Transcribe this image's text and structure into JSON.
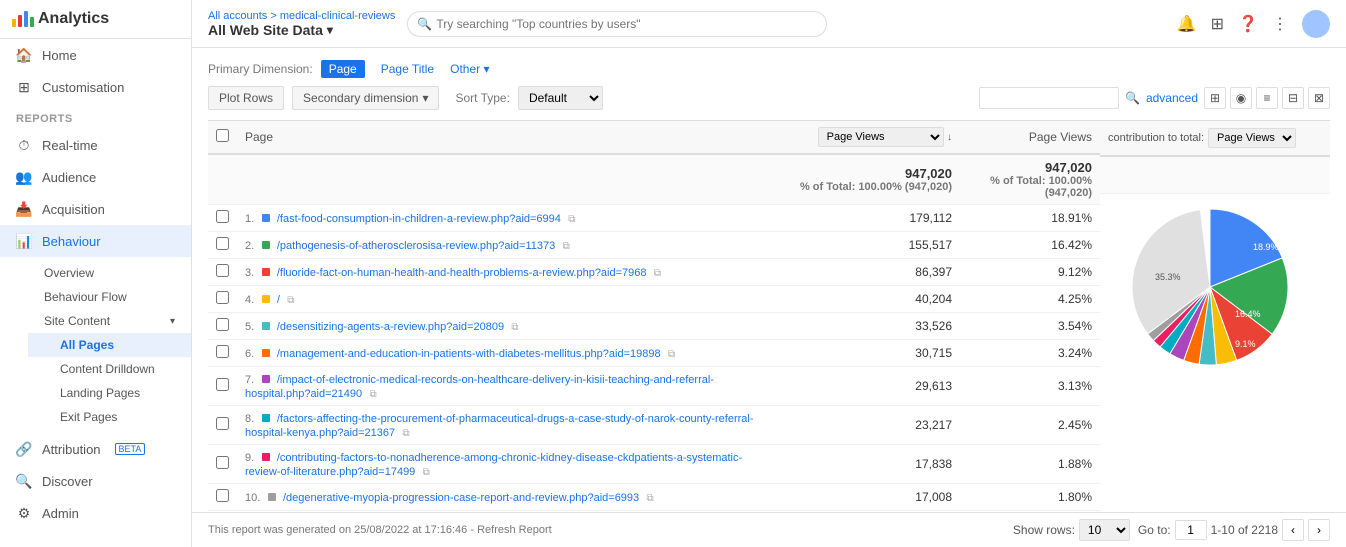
{
  "app": {
    "title": "Analytics",
    "logo_alt": "Google Analytics"
  },
  "topbar": {
    "breadcrumb": "All accounts > medical-clinical-reviews",
    "property": "All Web Site Data",
    "search_placeholder": "Try searching \"Top countries by users\""
  },
  "sidebar": {
    "nav_items": [
      {
        "id": "home",
        "label": "Home",
        "icon": "🏠"
      },
      {
        "id": "customisation",
        "label": "Customisation",
        "icon": "⊞"
      }
    ],
    "reports_label": "REPORTS",
    "report_items": [
      {
        "id": "realtime",
        "label": "Real-time",
        "icon": "⏱"
      },
      {
        "id": "audience",
        "label": "Audience",
        "icon": "👥"
      },
      {
        "id": "acquisition",
        "label": "Acquisition",
        "icon": "📥"
      },
      {
        "id": "behaviour",
        "label": "Behaviour",
        "icon": "📊",
        "active": true
      },
      {
        "id": "attribution",
        "label": "Attribution",
        "icon": "🔗",
        "badge": "BETA"
      },
      {
        "id": "discover",
        "label": "Discover",
        "icon": "🔍"
      },
      {
        "id": "admin",
        "label": "Admin",
        "icon": "⚙"
      }
    ],
    "behaviour_subitems": [
      {
        "id": "overview",
        "label": "Overview"
      },
      {
        "id": "behaviour-flow",
        "label": "Behaviour Flow"
      },
      {
        "id": "site-content",
        "label": "Site Content",
        "expandable": true
      },
      {
        "id": "all-pages",
        "label": "All Pages",
        "active": true
      },
      {
        "id": "content-drilldown",
        "label": "Content Drilldown"
      },
      {
        "id": "landing-pages",
        "label": "Landing Pages"
      },
      {
        "id": "exit-pages",
        "label": "Exit Pages"
      }
    ]
  },
  "primary_dimension": {
    "label": "Primary Dimension:",
    "options": [
      "Page",
      "Page Title",
      "Other ▾"
    ],
    "active": "Page"
  },
  "toolbar": {
    "plot_rows": "Plot Rows",
    "secondary_dim": "Secondary dimension",
    "sort_label": "Sort Type:",
    "sort_default": "Default",
    "advanced": "advanced"
  },
  "table": {
    "headers": {
      "page": "Page",
      "page_views_select": "Page Views",
      "page_views_col": "Page Views",
      "contribution_label": "contribution to total:",
      "contribution_select": "Page Views"
    },
    "total": {
      "value": "947,020",
      "pct_label": "% of Total: 100.00% (947,020)"
    },
    "rows": [
      {
        "num": "1",
        "color": "#4285f4",
        "url": "/fast-food-consumption-in-children-a-review.php?aid=6994",
        "views": "179,112",
        "pct": "18.91%"
      },
      {
        "num": "2",
        "color": "#34a853",
        "url": "/pathogenesis-of-atherosclerosisa-review.php?aid=11373",
        "views": "155,517",
        "pct": "16.42%"
      },
      {
        "num": "3",
        "color": "#ea4335",
        "url": "/fluoride-fact-on-human-health-and-health-problems-a-review.php?aid=7968",
        "views": "86,397",
        "pct": "9.12%"
      },
      {
        "num": "4",
        "color": "#fbbc04",
        "url": "/",
        "views": "40,204",
        "pct": "4.25%"
      },
      {
        "num": "5",
        "color": "#46bdc6",
        "url": "/desensitizing-agents-a-review.php?aid=20809",
        "views": "33,526",
        "pct": "3.54%"
      },
      {
        "num": "6",
        "color": "#ff6d00",
        "url": "/management-and-education-in-patients-with-diabetes-mellitus.php?aid=19898",
        "views": "30,715",
        "pct": "3.24%"
      },
      {
        "num": "7",
        "color": "#ab47bc",
        "url": "/impact-of-electronic-medical-records-on-healthcare-delivery-in-kisii-teaching-and-referral-hospital.php?aid=21490",
        "views": "29,613",
        "pct": "3.13%"
      },
      {
        "num": "8",
        "color": "#00acc1",
        "url": "/factors-affecting-the-procurement-of-pharmaceutical-drugs-a-case-study-of-narok-county-referral-hospital-kenya.php?aid=21367",
        "views": "23,217",
        "pct": "2.45%"
      },
      {
        "num": "9",
        "color": "#e91e63",
        "url": "/contributing-factors-to-nonadherence-among-chronic-kidney-disease-ckdpatients-a-systematic-review-of-literature.php?aid=17499",
        "views": "17,838",
        "pct": "1.88%"
      },
      {
        "num": "10",
        "color": "#9e9e9e",
        "url": "/degenerative-myopia-progression-case-report-and-review.php?aid=6993",
        "views": "17,008",
        "pct": "1.80%"
      }
    ]
  },
  "chart": {
    "segments": [
      {
        "label": "18.9%",
        "color": "#4285f4",
        "pct": 18.91,
        "startAngle": 0
      },
      {
        "label": "16.4%",
        "color": "#34a853",
        "pct": 16.42,
        "startAngle": 68
      },
      {
        "label": "9.1%",
        "color": "#ea4335",
        "pct": 9.12,
        "startAngle": 127
      },
      {
        "label": "4.25%",
        "color": "#fbbc04",
        "pct": 4.25,
        "startAngle": 160
      },
      {
        "label": "3.54%",
        "color": "#46bdc6",
        "pct": 3.54,
        "startAngle": 175
      },
      {
        "label": "3.24%",
        "color": "#ff6d00",
        "pct": 3.24,
        "startAngle": 188
      },
      {
        "label": "3.13%",
        "color": "#ab47bc",
        "pct": 3.13,
        "startAngle": 200
      },
      {
        "label": "2.45%",
        "color": "#00acc1",
        "pct": 2.45,
        "startAngle": 211
      },
      {
        "label": "1.88%",
        "color": "#e91e63",
        "pct": 1.88,
        "startAngle": 220
      },
      {
        "label": "1.80%",
        "color": "#9e9e9e",
        "pct": 1.8,
        "startAngle": 227
      },
      {
        "label": "rest",
        "color": "#e0e0e0",
        "pct": 33.28,
        "startAngle": 233
      }
    ],
    "label_189": "18.9%",
    "label_164": "16.4%",
    "label_rest": "35.3%",
    "label_91": "9.1%"
  },
  "footer": {
    "generated": "This report was generated on 25/08/2022 at 17:16:46 - Refresh Report",
    "show_rows_label": "Show rows:",
    "show_rows_value": "10",
    "go_to_label": "Go to:",
    "go_to_value": "1",
    "page_range": "1-10 of 2218"
  }
}
